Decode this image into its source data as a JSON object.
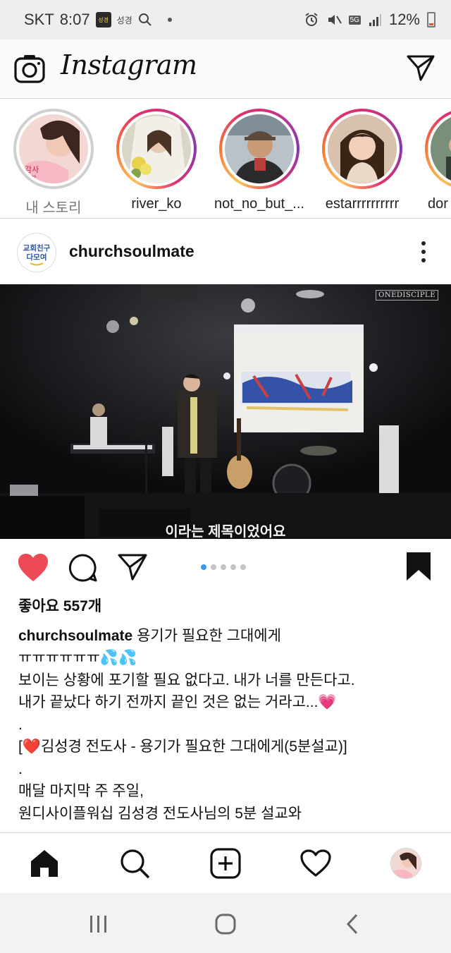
{
  "status_bar": {
    "carrier": "SKT",
    "time": "8:07",
    "notification_label": "성경",
    "battery": "12%",
    "network": "5G"
  },
  "header": {
    "app_title": "Instagram"
  },
  "stories": [
    {
      "name": "내 스토리",
      "seen": true
    },
    {
      "name": "river_ko",
      "seen": false
    },
    {
      "name": "not_no_but_...",
      "seen": false
    },
    {
      "name": "estarrrrrrrrrr",
      "seen": false
    },
    {
      "name": "dor",
      "seen": false
    }
  ],
  "post": {
    "username": "churchsoulmate",
    "avatar_text_top": "교회친구",
    "avatar_text_bottom": "다모여",
    "media": {
      "watermark": "ONEDISCIPLE",
      "subtitle": "이라는 제목이었어요",
      "carousel_count": 5,
      "carousel_active": 1
    },
    "likes": "좋아요 557개",
    "caption": {
      "first_line_text": "용기가 필요한 그대에게",
      "lines": [
        "ㅠㅠㅠㅠㅠㅠ💦💦",
        "보이는 상황에 포기할 필요 없다고. 내가 너를 만든다고.",
        "내가 끝났다 하기 전까지 끝인 것은 없는 거라고...💗",
        ".",
        "[❤️김성경 전도사 - 용기가 필요한 그대에게(5분설교)]",
        ".",
        "매달 마지막 주 주일,",
        "원디사이플워십 김성경 전도사님의 5분 설교와"
      ]
    }
  },
  "colors": {
    "like_red": "#ed4956",
    "carousel_active": "#3897f0",
    "divider": "#dbdbdb"
  },
  "icons": {
    "header": [
      "camera-icon",
      "direct-message-icon"
    ],
    "actions": [
      "heart-icon",
      "comment-icon",
      "share-icon",
      "bookmark-icon"
    ],
    "bottom_nav": [
      "home-icon",
      "search-icon",
      "add-post-icon",
      "activity-heart-icon",
      "profile-avatar"
    ],
    "android_nav": [
      "recent-apps-icon",
      "home-circle-icon",
      "back-icon"
    ]
  }
}
